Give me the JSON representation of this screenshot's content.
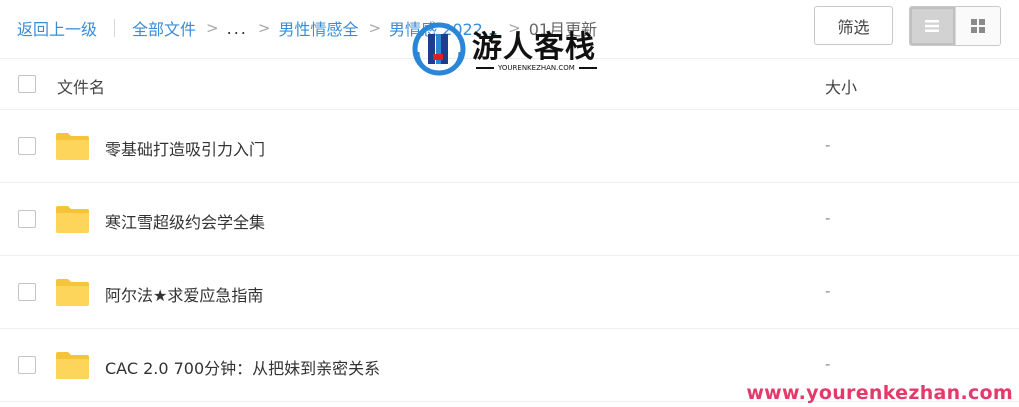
{
  "breadcrumb": {
    "back": "返回上一级",
    "all_files": "全部文件",
    "ellipsis": "...",
    "level1": "男性情感全",
    "level2": "男情感 2022...",
    "current": "01月更新"
  },
  "toolbar": {
    "filter_label": "筛选",
    "view_modes": [
      "list-view-icon",
      "grid-view-icon"
    ],
    "active_view": "list"
  },
  "watermark": {
    "logo_text": "游人客栈",
    "logo_subtext": "YOURENKEZHAN.COM",
    "url": "www.yourenkezhan.com",
    "url_color": "#e4396b"
  },
  "columns": {
    "name": "文件名",
    "size": "大小"
  },
  "files": [
    {
      "name": "零基础打造吸引力入门",
      "size": "-",
      "type": "folder"
    },
    {
      "name": "寒江雪超级约会学全集",
      "size": "-",
      "type": "folder"
    },
    {
      "name": "阿尔法★求爱应急指南",
      "size": "-",
      "type": "folder"
    },
    {
      "name": "CAC 2.0 700分钟：从把妹到亲密关系",
      "size": "-",
      "type": "folder"
    }
  ],
  "colors": {
    "link": "#3b8cd8",
    "folder": "#fdd55a",
    "divider": "#eeeeee"
  }
}
